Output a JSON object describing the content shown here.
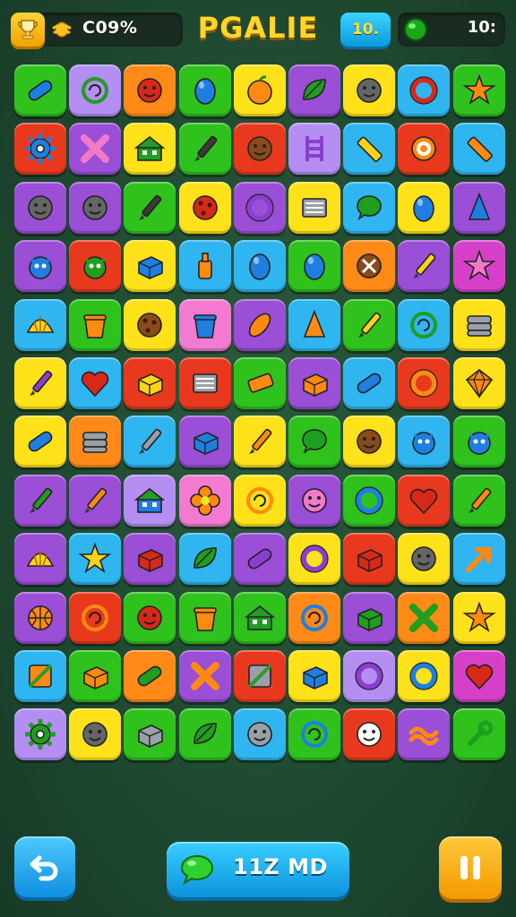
{
  "header": {
    "score_label": "C09%",
    "title": "PGALIE",
    "level_label": "10.",
    "gems_label": "10:"
  },
  "footer": {
    "hint_label": "11Z MD"
  },
  "icons": {
    "trophy": "trophy-icon",
    "coin": "coin-icon",
    "gem": "green-gem-icon",
    "undo": "undo-arrow-icon",
    "pause": "pause-icon",
    "hint": "speech-bubble-icon"
  },
  "colors": {
    "green": "#2fc21d",
    "purple": "#9b4ed6",
    "orange": "#ff8a18",
    "yellow": "#ffe21a",
    "blue": "#2fb5f0",
    "red": "#e8391e",
    "lavender": "#b48ef2",
    "magenta": "#d640c8",
    "pink": "#f27ad0",
    "accent_title": "#ffd629"
  },
  "board": {
    "columns": 9,
    "rows": 12,
    "tiles": [
      [
        "green:blue-capsule",
        "lavender:green-swirl",
        "orange:red-face",
        "green:blue-egg",
        "yellow:orange-fruit",
        "purple:green-leaf",
        "yellow:girl-face",
        "blue:red-ring",
        "green:orange-star"
      ],
      [
        "red:blue-gear",
        "purple:pink-x",
        "yellow:green-house",
        "green:dark-brush",
        "red:brown-face",
        "lavender:purple-ladder",
        "blue:yellow-ruler",
        "red:orange-target",
        "blue:orange-ruler"
      ],
      [
        "purple:girl-face",
        "purple:boy-face",
        "green:dark-pencil",
        "yellow:red-cookie",
        "purple:purple-ring",
        "yellow:gray-book",
        "blue:green-bubble",
        "yellow:blue-egg",
        "purple:blue-cone"
      ],
      [
        "purple:blue-monster",
        "red:green-monster",
        "yellow:blue-box",
        "blue:orange-bottle",
        "blue:blue-egg",
        "green:blue-egg",
        "orange:brown-shield",
        "purple:yellow-pencil",
        "magenta:pink-star"
      ],
      [
        "blue:yellow-shell",
        "green:orange-cup",
        "yellow:brown-cookie",
        "pink:blue-cup",
        "purple:orange-feather",
        "blue:orange-cone",
        "green:yellow-pencil",
        "blue:green-swirl",
        "yellow:gray-stack"
      ],
      [
        "yellow:purple-brush",
        "blue:red-heart",
        "red:yellow-box",
        "red:gray-book",
        "green:orange-eraser",
        "purple:orange-box",
        "blue:blue-capsule",
        "red:orange-ring",
        "yellow:orange-gem"
      ],
      [
        "yellow:blue-capsule",
        "orange:gray-stack",
        "blue:gray-pencil",
        "purple:blue-box",
        "yellow:orange-pencil",
        "green:green-bubble",
        "yellow:brown-face",
        "blue:blue-monster",
        "green:blue-monster"
      ],
      [
        "purple:green-brush",
        "purple:orange-pencil",
        "lavender:blue-house",
        "pink:orange-flower",
        "yellow:orange-swirl",
        "purple:pink-face",
        "green:blue-ring",
        "red:red-heart",
        "green:orange-pencil"
      ],
      [
        "purple:yellow-shell",
        "blue:yellow-star",
        "purple:red-box",
        "blue:green-leaf",
        "purple:purple-capsule",
        "yellow:purple-ring",
        "red:red-box",
        "yellow:boy-face",
        "blue:orange-arrow"
      ],
      [
        "purple:orange-ball",
        "red:orange-swirl",
        "green:red-face",
        "green:orange-cup",
        "green:green-house",
        "orange:blue-swirl",
        "purple:green-box",
        "orange:green-x",
        "yellow:orange-star"
      ],
      [
        "blue:orange-square",
        "green:orange-box",
        "orange:green-capsule",
        "purple:orange-x",
        "red:gray-square",
        "yellow:blue-box",
        "lavender:purple-ring",
        "yellow:blue-ring",
        "magenta:red-heart"
      ],
      [
        "lavender:green-gear",
        "yellow:boy-face",
        "green:gray-box",
        "green:green-leaf",
        "blue:gray-face",
        "green:blue-swirl",
        "red:white-face",
        "purple:orange-wave",
        "green:green-wrench"
      ]
    ]
  }
}
